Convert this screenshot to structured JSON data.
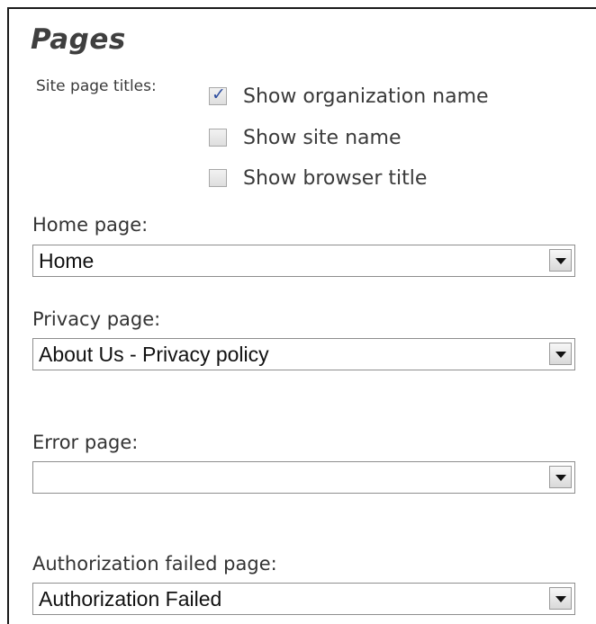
{
  "section": {
    "title": "Pages"
  },
  "site_titles": {
    "label": "Site page titles:",
    "options": [
      {
        "label": "Show organization name",
        "checked": true
      },
      {
        "label": "Show site name",
        "checked": false
      },
      {
        "label": "Show browser title",
        "checked": false
      }
    ]
  },
  "fields": {
    "home": {
      "label": "Home page:",
      "value": "Home"
    },
    "privacy": {
      "label": "Privacy page:",
      "value": "About Us - Privacy policy"
    },
    "error": {
      "label": "Error page:",
      "value": ""
    },
    "auth_failed": {
      "label": "Authorization failed page:",
      "value": "Authorization Failed"
    }
  },
  "icons": {
    "checkmark": "✓",
    "dropdown": "chevron-down-icon"
  },
  "colors": {
    "check": "#2f4fa0",
    "border": "#8e8e8e"
  }
}
